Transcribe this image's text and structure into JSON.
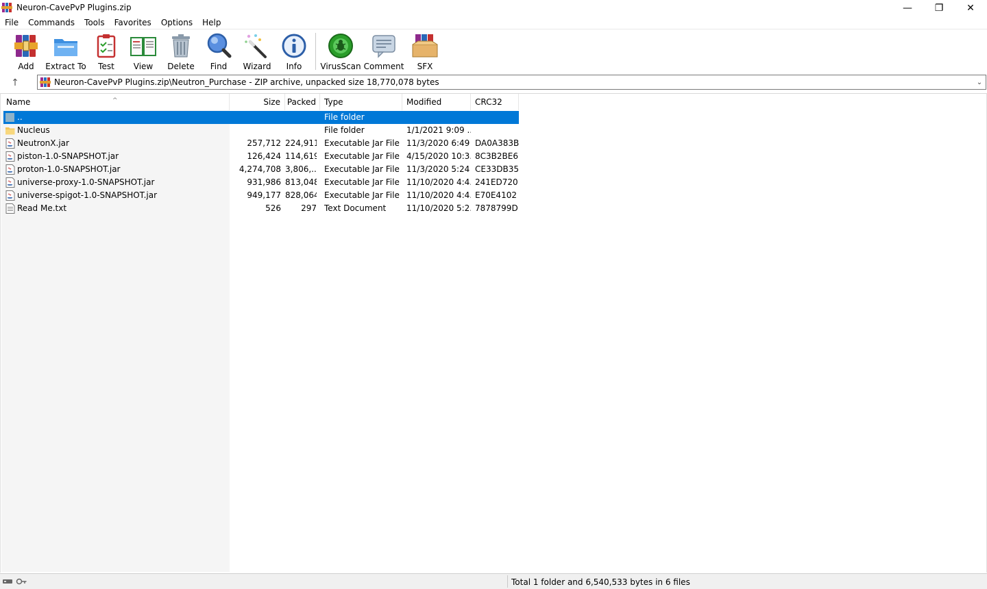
{
  "window": {
    "title": "Neuron-CavePvP Plugins.zip",
    "minimize_glyph": "—",
    "maximize_glyph": "❐",
    "close_glyph": "✕"
  },
  "menu": [
    "File",
    "Commands",
    "Tools",
    "Favorites",
    "Options",
    "Help"
  ],
  "toolbar": {
    "add": "Add",
    "extract_to": "Extract To",
    "test": "Test",
    "view": "View",
    "delete": "Delete",
    "find": "Find",
    "wizard": "Wizard",
    "info": "Info",
    "virusscan": "VirusScan",
    "comment": "Comment",
    "sfx": "SFX"
  },
  "address": {
    "up_glyph": "↑",
    "path": "Neuron-CavePvP Plugins.zip\\Neutron_Purchase - ZIP archive, unpacked size 18,770,078 bytes",
    "dropdown_glyph": "⌄"
  },
  "columns": {
    "name": "Name",
    "size": "Size",
    "packed": "Packed",
    "type": "Type",
    "modified": "Modified",
    "crc32": "CRC32",
    "sort_glyph": "^"
  },
  "files": [
    {
      "name": "..",
      "size": "",
      "packed": "",
      "type": "File folder",
      "modified": "",
      "crc": "",
      "icon": "parent-folder-icon"
    },
    {
      "name": "Nucleus",
      "size": "",
      "packed": "",
      "type": "File folder",
      "modified": "1/1/2021 9:09 ...",
      "crc": "",
      "icon": "folder-icon"
    },
    {
      "name": "NeutronX.jar",
      "size": "257,712",
      "packed": "224,911",
      "type": "Executable Jar File",
      "modified": "11/3/2020 6:49 ...",
      "crc": "DA0A383B",
      "icon": "jar-file-icon"
    },
    {
      "name": "piston-1.0-SNAPSHOT.jar",
      "size": "126,424",
      "packed": "114,619",
      "type": "Executable Jar File",
      "modified": "4/15/2020 10:3...",
      "crc": "8C3B2BE6",
      "icon": "jar-file-icon"
    },
    {
      "name": "proton-1.0-SNAPSHOT.jar",
      "size": "4,274,708",
      "packed": "3,806,...",
      "type": "Executable Jar File",
      "modified": "11/3/2020 5:24 ...",
      "crc": "CE33DB35",
      "icon": "jar-file-icon"
    },
    {
      "name": "universe-proxy-1.0-SNAPSHOT.jar",
      "size": "931,986",
      "packed": "813,048",
      "type": "Executable Jar File",
      "modified": "11/10/2020 4:4...",
      "crc": "241ED720",
      "icon": "jar-file-icon"
    },
    {
      "name": "universe-spigot-1.0-SNAPSHOT.jar",
      "size": "949,177",
      "packed": "828,064",
      "type": "Executable Jar File",
      "modified": "11/10/2020 4:4...",
      "crc": "E70E4102",
      "icon": "jar-file-icon"
    },
    {
      "name": "Read Me.txt",
      "size": "526",
      "packed": "297",
      "type": "Text Document",
      "modified": "11/10/2020 5:2...",
      "crc": "7878799D",
      "icon": "text-file-icon"
    }
  ],
  "status": {
    "text": "Total 1 folder and 6,540,533 bytes in 6 files"
  },
  "colors": {
    "selection": "#0078d7",
    "left_pane": "#f5f5f5",
    "status_bar": "#f0f0f0"
  }
}
